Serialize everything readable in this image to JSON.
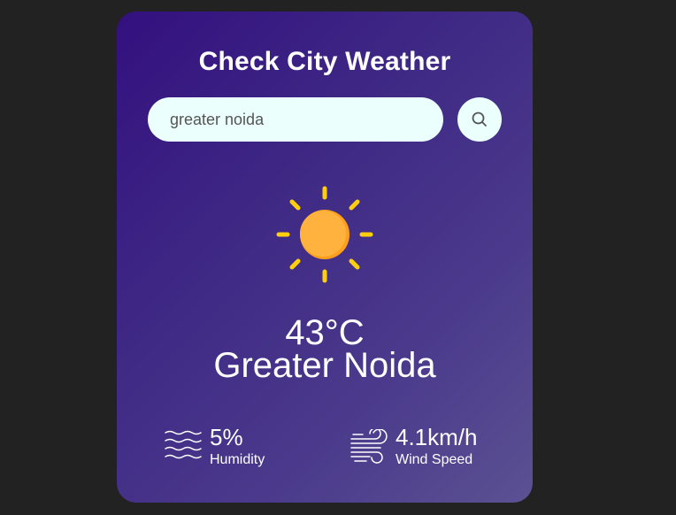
{
  "app": {
    "title": "Check City Weather"
  },
  "search": {
    "value": "greater noida",
    "button_icon": "search-icon"
  },
  "weather": {
    "icon": "sun-icon",
    "temperature": "43°C",
    "city": "Greater Noida"
  },
  "details": {
    "humidity": {
      "icon": "waves-icon",
      "value": "5%",
      "label": "Humidity"
    },
    "wind": {
      "icon": "wind-icon",
      "value": "4.1km/h",
      "label": "Wind Speed"
    }
  },
  "colors": {
    "page_background": "#222222",
    "card_gradient_start": "#33107f",
    "card_gradient_end": "#5b5192",
    "input_background": "#ebfffc",
    "sun_core": "#ffb23e",
    "sun_rays": "#ffcf0d"
  }
}
